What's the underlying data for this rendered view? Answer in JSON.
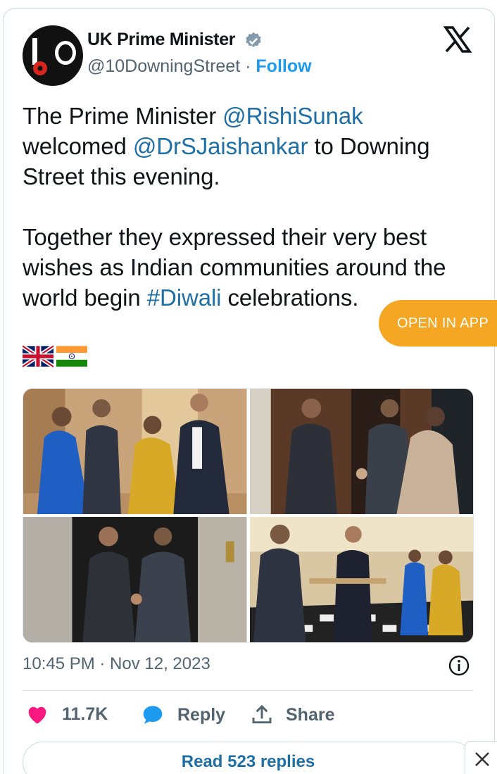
{
  "author": {
    "name": "UK Prime Minister",
    "handle": "@10DowningStreet",
    "separator": "·",
    "follow_label": "Follow",
    "verified": true
  },
  "tweet": {
    "line1_a": "The Prime Minister ",
    "mention1": "@RishiSunak",
    "line2_a": "welcomed ",
    "mention2": "@DrSJaishankar",
    "line2_b": " to Downing Street this evening.",
    "para2_a": "Together they expressed their very best wishes as Indian communities around the world begin ",
    "hashtag": "#Diwali",
    "para2_b": " celebrations."
  },
  "flags": [
    "uk-flag",
    "india-flag"
  ],
  "open_in_app_label": "OPEN IN APP",
  "timestamp": "10:45 PM · Nov 12, 2023",
  "actions": {
    "likes_count": "11.7K",
    "reply_label": "Reply",
    "share_label": "Share"
  },
  "read_replies_label": "Read 523 replies",
  "colors": {
    "accent": "#1d9bf0",
    "mention": "#1d6fa5",
    "open_app": "#f5a623",
    "like": "#f91880"
  },
  "icons": [
    "x-logo-icon",
    "verified-badge-icon",
    "info-icon",
    "heart-icon",
    "reply-bubble-icon",
    "share-icon",
    "close-icon"
  ]
}
